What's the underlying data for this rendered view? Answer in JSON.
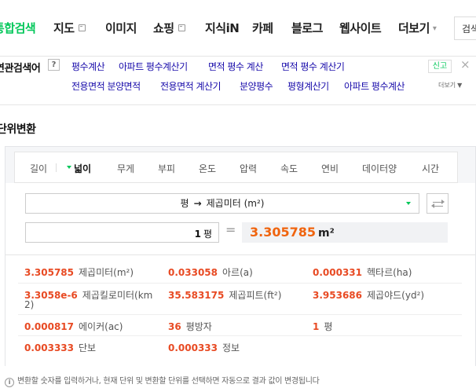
{
  "nav": {
    "tabs": [
      {
        "label": "통합검색"
      },
      {
        "label": "지도"
      },
      {
        "label": "이미지"
      },
      {
        "label": "쇼핑"
      },
      {
        "label": "지식iN"
      },
      {
        "label": "카페"
      },
      {
        "label": "블로그"
      },
      {
        "label": "웹사이트"
      },
      {
        "label": "더보기"
      }
    ],
    "search_value": "검색"
  },
  "related": {
    "title": "연관검색어",
    "help": "?",
    "report": "신고",
    "more": "더보기",
    "links": [
      "평수계산",
      "아파트 평수계산기",
      "면적 평수 계산",
      "면적 평수 계산기",
      "전용면적 분양면적",
      "전용면적 계산기",
      "분양평수",
      "평형계산기",
      "아파트 평수계산"
    ]
  },
  "section": {
    "title": "단위변환"
  },
  "converter": {
    "categories": [
      "길이",
      "넓이",
      "무게",
      "부피",
      "온도",
      "압력",
      "속도",
      "연비",
      "데이터양",
      "시간"
    ],
    "active_category": "넓이",
    "from_unit": "평",
    "to_unit": "제곱미터 (m²)",
    "input_value": "1",
    "input_unit": "평",
    "equals": "=",
    "result_value": "3.305785",
    "result_unit": "m²"
  },
  "results": [
    {
      "value": "3.305785",
      "unit": "제곱미터(m²)"
    },
    {
      "value": "0.033058",
      "unit": "아르(a)"
    },
    {
      "value": "0.000331",
      "unit": "헥타르(ha)"
    },
    {
      "value": "3.3058e-6",
      "unit": "제곱킬로미터(km",
      "unit_wrap": "2)"
    },
    {
      "value": "35.583175",
      "unit": "제곱피트(ft²)"
    },
    {
      "value": "3.953686",
      "unit": "제곱야드(yd²)"
    },
    {
      "value": "0.000817",
      "unit": "에이커(ac)"
    },
    {
      "value": "36",
      "unit": "평방자"
    },
    {
      "value": "1",
      "unit": "평"
    },
    {
      "value": "0.003333",
      "unit": "단보"
    },
    {
      "value": "0.000333",
      "unit": "정보"
    }
  ],
  "note": "변환할 숫자를 입력하거나, 현재 단위 및 변환할 단위를 선택하면 자동으로 결과 값이 변경됩니다",
  "colors": {
    "accent_green": "#03c75a",
    "result_orange": "#f0640e",
    "value_red": "#e84a23"
  }
}
